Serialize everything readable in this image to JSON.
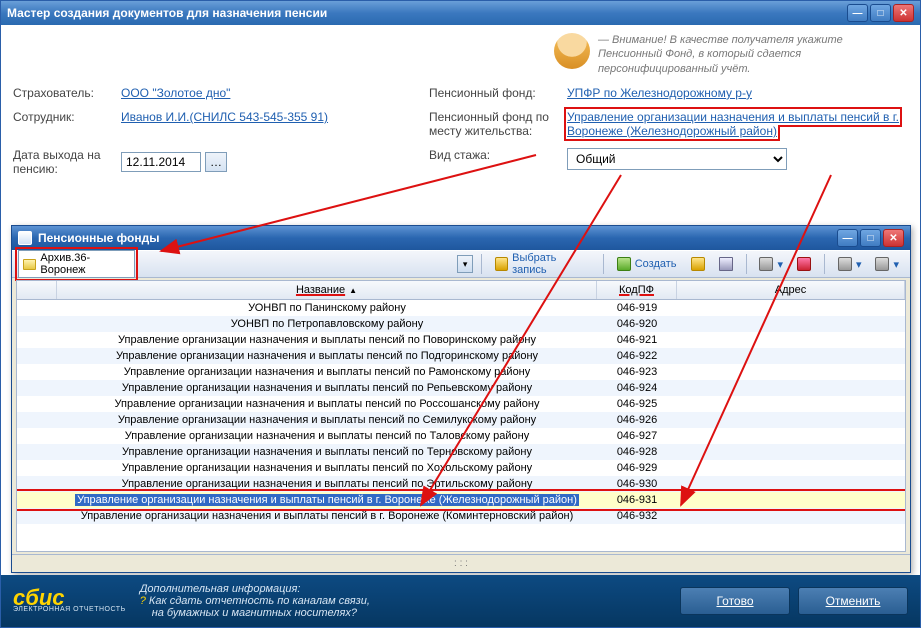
{
  "outer": {
    "title": "Мастер создания документов для назначения пенсии",
    "hint": "— Внимание! В качестве получателя укажите Пенсионный Фонд, в который сдается персонифицированный учёт."
  },
  "form": {
    "insurer_label": "Страхователь:",
    "insurer_value": "ООО \"Золотое дно\"",
    "pf_label": "Пенсионный фонд:",
    "pf_value": "УПФР по Железнодорожному р-у",
    "employee_label": "Сотрудник:",
    "employee_value": "Иванов И.И.(СНИЛС 543-545-355 91)",
    "pf_residence_label": "Пенсионный фонд по месту жительства:",
    "pf_residence_value": "Управление организации назначения и выплаты пенсий в г. Воронеже (Железнодорожный район)",
    "retire_date_label": "Дата выхода на пенсию:",
    "retire_date_value": "12.11.2014",
    "stazh_label": "Вид стажа:",
    "stazh_value": "Общий"
  },
  "inner": {
    "title": "Пенсионные фонды",
    "archive": "Архив.36-Воронеж",
    "tb_select": "Выбрать запись",
    "tb_create": "Создать",
    "columns": {
      "name": "Название",
      "code": "КодПФ",
      "addr": "Адрес"
    },
    "rows": [
      {
        "name": "УОНВП по Панинскому району",
        "code": "046-919"
      },
      {
        "name": "УОНВП по Петропавловскому району",
        "code": "046-920"
      },
      {
        "name": "Управление организации назначения и выплаты пенсий по Поворинскому району",
        "code": "046-921"
      },
      {
        "name": "Управление организации назначения и выплаты пенсий по Подгоринскому району",
        "code": "046-922"
      },
      {
        "name": "Управление организации назначения и выплаты пенсий по Рамонскому району",
        "code": "046-923"
      },
      {
        "name": "Управление организации назначения и выплаты пенсий по Репьевскому району",
        "code": "046-924"
      },
      {
        "name": "Управление организации назначения и выплаты пенсий по Россошанскому району",
        "code": "046-925"
      },
      {
        "name": "Управление организации назначения и выплаты пенсий по Семилукскому району",
        "code": "046-926"
      },
      {
        "name": "Управление организации назначения и выплаты пенсий по Таловскому району",
        "code": "046-927"
      },
      {
        "name": "Управление организации назначения и выплаты пенсий по Терновскому району",
        "code": "046-928"
      },
      {
        "name": "Управление организации назначения и выплаты пенсий по Хохольскому району",
        "code": "046-929"
      },
      {
        "name": "Управление организации назначения и выплаты пенсий по Эртильскому району",
        "code": "046-930"
      },
      {
        "name": "Управление организации назначения и выплаты пенсий в г. Воронеже (Железнодорожный район)",
        "code": "046-931"
      },
      {
        "name": "Управление организации назначения и выплаты пенсий в г. Воронеже (Коминтерновский район)",
        "code": "046-932"
      }
    ],
    "selected_index": 12
  },
  "footer": {
    "logo_main": "сбис",
    "logo_sub": "ЭЛЕКТРОННАЯ ОТЧЕТНОСТЬ",
    "info_title": "Дополнительная информация:",
    "info_line1": "Как сдать отчетность по каналам связи,",
    "info_line2": "на бумажных и магнитных носителях?",
    "done": "Готово",
    "cancel": "Отменить"
  }
}
